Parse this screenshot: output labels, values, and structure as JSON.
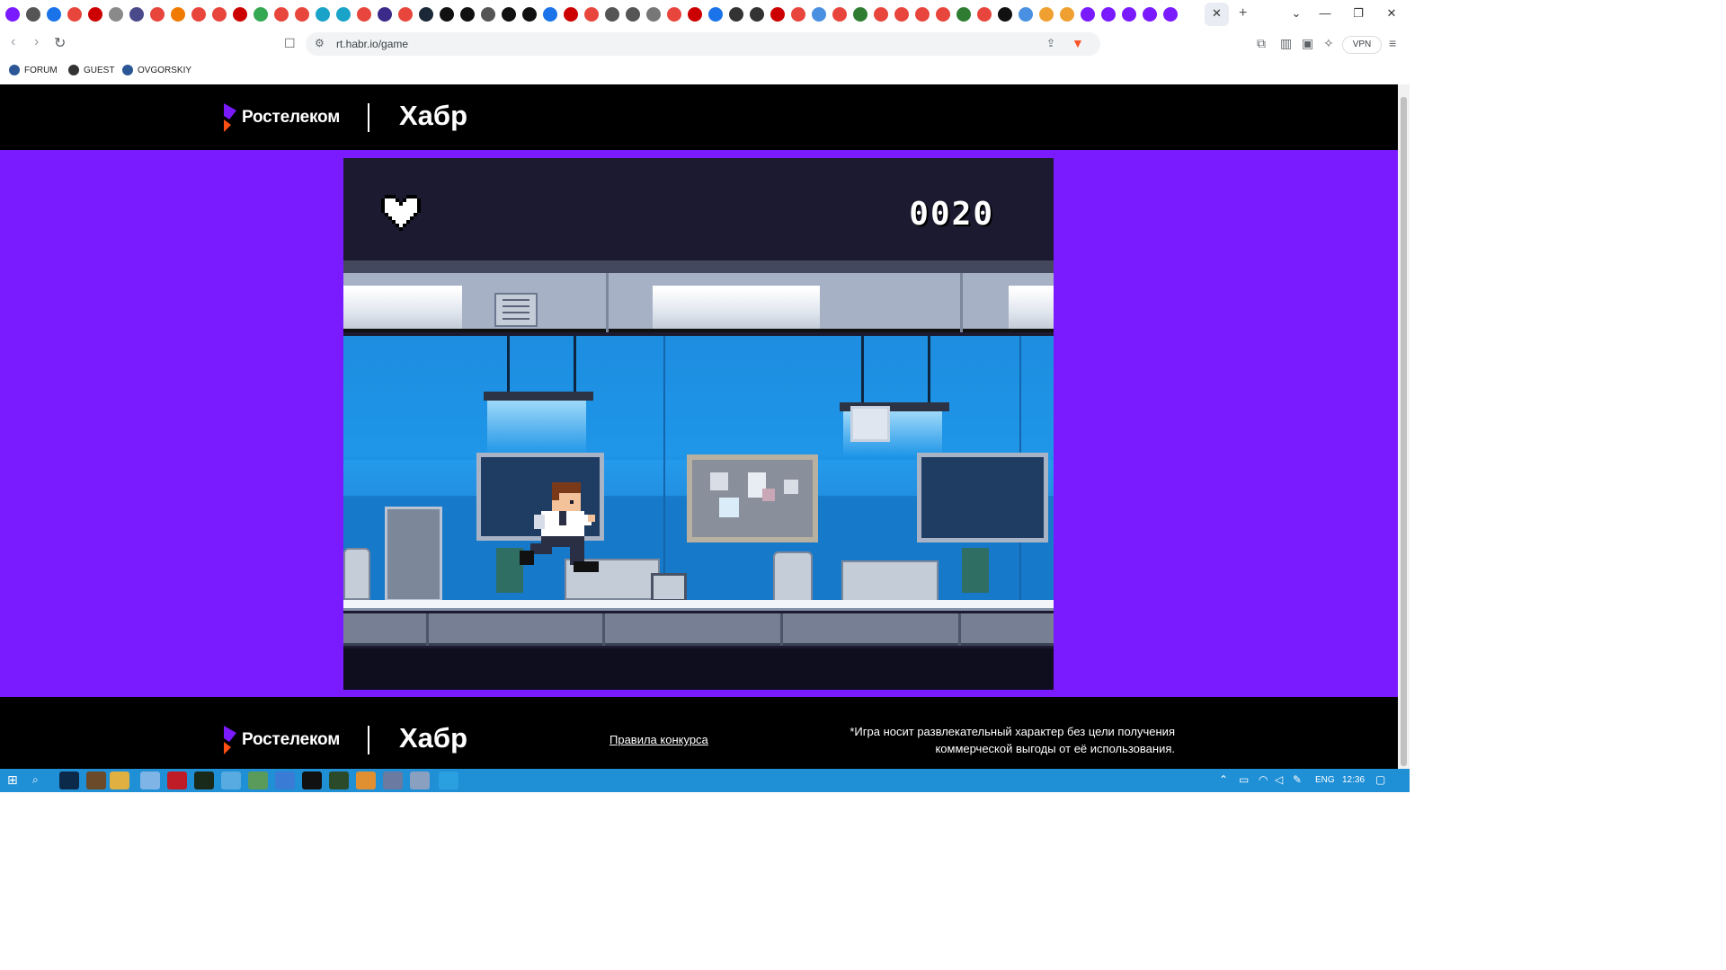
{
  "browser": {
    "url": "rt.habr.io/game",
    "vpn_label": "VPN",
    "active_tab_close": "✕",
    "new_tab": "+",
    "tab_favicon_colors": [
      "#7a1aff",
      "#555555",
      "#1a73e8",
      "#e8453c",
      "#cc0000",
      "#8a8a8a",
      "#4a4a8a",
      "#e8453c",
      "#f07b00",
      "#e8453c",
      "#e8453c",
      "#cc0000",
      "#34a853",
      "#e8453c",
      "#e8453c",
      "#1aa3c8",
      "#1aa3c8",
      "#e8453c",
      "#3b2a8a",
      "#e8453c",
      "#1b2838",
      "#111111",
      "#111111",
      "#555555",
      "#111111",
      "#111111",
      "#1a73e8",
      "#cc0000",
      "#e8453c",
      "#555555",
      "#555555",
      "#777777",
      "#e8453c",
      "#cc0000",
      "#1a73e8",
      "#333333",
      "#333333",
      "#cc0000",
      "#e8453c",
      "#4a90e2",
      "#e8453c",
      "#2e7d32",
      "#e8453c",
      "#e8453c",
      "#e8453c",
      "#e8453c",
      "#2e7d32",
      "#e8453c",
      "#111111",
      "#4a90e2",
      "#f0a030",
      "#f0a030",
      "#7a1aff",
      "#7a1aff",
      "#7a1aff",
      "#7a1aff",
      "#7a1aff"
    ]
  },
  "bookmarks": [
    {
      "label": "FORUM"
    },
    {
      "label": "GUEST"
    },
    {
      "label": "OVGORSKIY"
    }
  ],
  "header": {
    "brand": "Ростелеком",
    "partner": "Хабр"
  },
  "game": {
    "lives": 1,
    "score": "0020"
  },
  "footer": {
    "brand": "Ростелеком",
    "partner": "Хабр",
    "rules_link": "Правила конкурса",
    "disclaimer_line1": "*Игра носит развлекательный характер без цели получения",
    "disclaimer_line2": "коммерческой выгоды от её использования."
  },
  "taskbar": {
    "language": "ENG",
    "time": "12:36"
  },
  "colors": {
    "page_bg": "#7a1aff",
    "header_bg": "#000000",
    "game_bg": "#1b1a30",
    "wall": "#1f96e8",
    "taskbar": "#1f8fd6"
  }
}
